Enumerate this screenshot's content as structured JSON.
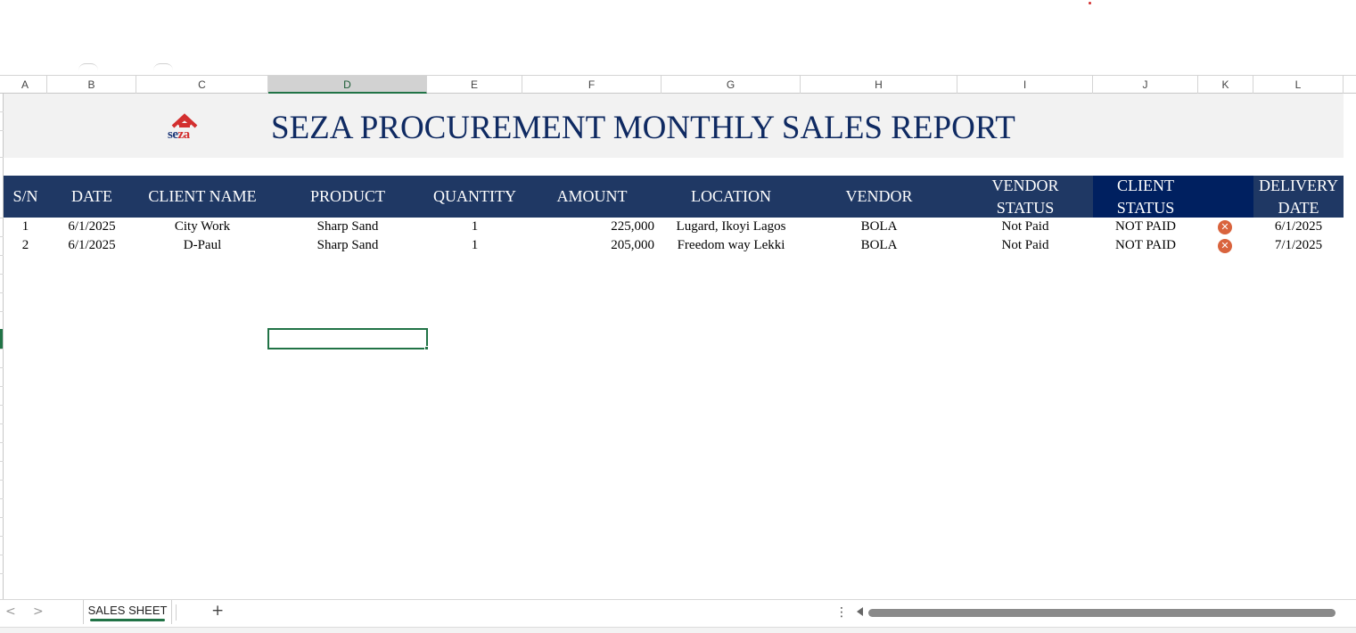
{
  "columns": [
    "A",
    "B",
    "C",
    "D",
    "E",
    "F",
    "G",
    "H",
    "I",
    "J",
    "K",
    "L"
  ],
  "selected_column": "D",
  "title": "SEZA PROCUREMENT MONTHLY SALES REPORT",
  "logo": {
    "part1": "se",
    "part2": "za"
  },
  "headers": {
    "sn": "S/N",
    "date": "DATE",
    "client_name": "CLIENT NAME",
    "product": "PRODUCT",
    "quantity": "QUANTITY",
    "amount": "AMOUNT",
    "location": "LOCATION",
    "vendor": "VENDOR",
    "vendor_status_1": "VENDOR",
    "vendor_status_2": "STATUS",
    "client_status_1": "CLIENT",
    "client_status_2": "STATUS",
    "delivery_date_1": "DELIVERY",
    "delivery_date_2": "DATE"
  },
  "rows": [
    {
      "sn": "1",
      "date": "6/1/2025",
      "client": "City Work",
      "product": "Sharp Sand",
      "quantity": "1",
      "amount": "225,000",
      "location": "Lugard, Ikoyi Lagos",
      "vendor": "BOLA",
      "vendor_status": "Not Paid",
      "client_status": "NOT PAID",
      "status_icon": "x-circle-icon",
      "delivery_date": "6/1/2025"
    },
    {
      "sn": "2",
      "date": "6/1/2025",
      "client": "D-Paul",
      "product": "Sharp Sand",
      "quantity": "1",
      "amount": "205,000",
      "location": "Freedom way Lekki",
      "vendor": "BOLA",
      "vendor_status": "Not Paid",
      "client_status": "NOT PAID",
      "status_icon": "x-circle-icon",
      "delivery_date": "7/1/2025"
    }
  ],
  "sheet_tabs": {
    "active": "SALES SHEET",
    "add": "+"
  },
  "colors": {
    "header_band": "#1f3864",
    "client_status_header": "#002060",
    "title_text": "#0f2a62",
    "selection_green": "#217346",
    "status_icon": "#d9633d"
  }
}
